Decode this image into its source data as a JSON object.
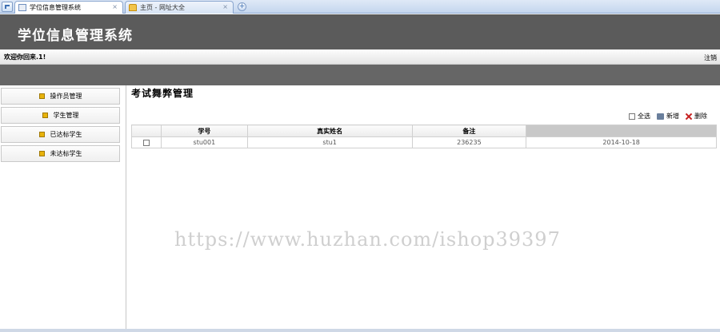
{
  "browser": {
    "tabs": [
      {
        "label": "学位信息管理系统",
        "active": true
      },
      {
        "label": "主页 - 网址大全",
        "active": false
      }
    ],
    "close_glyph": "×",
    "new_tab_glyph": "+"
  },
  "header": {
    "title": "学位信息管理系统"
  },
  "welcome": {
    "text": "欢迎你回来.1!",
    "logout": "注销"
  },
  "sidebar": {
    "items": [
      {
        "label": "操作员管理"
      },
      {
        "label": "学生管理"
      },
      {
        "label": "已达标学生"
      },
      {
        "label": "未达标学生"
      }
    ]
  },
  "main": {
    "title": "考试舞弊管理",
    "toolbar": {
      "select_all": "全选",
      "add": "新增",
      "delete": "删除"
    },
    "table": {
      "columns": [
        "学号",
        "真实姓名",
        "备注",
        ""
      ],
      "rows": [
        {
          "id": "stu001",
          "name": "stu1",
          "note": "236235",
          "date": "2014-10-18"
        }
      ]
    }
  },
  "watermark": "https://www.huzhan.com/ishop39397",
  "colors": {
    "header_bg": "#5b5b5b",
    "band_bg": "#666666",
    "icon_yellow": "#e8b30b"
  }
}
